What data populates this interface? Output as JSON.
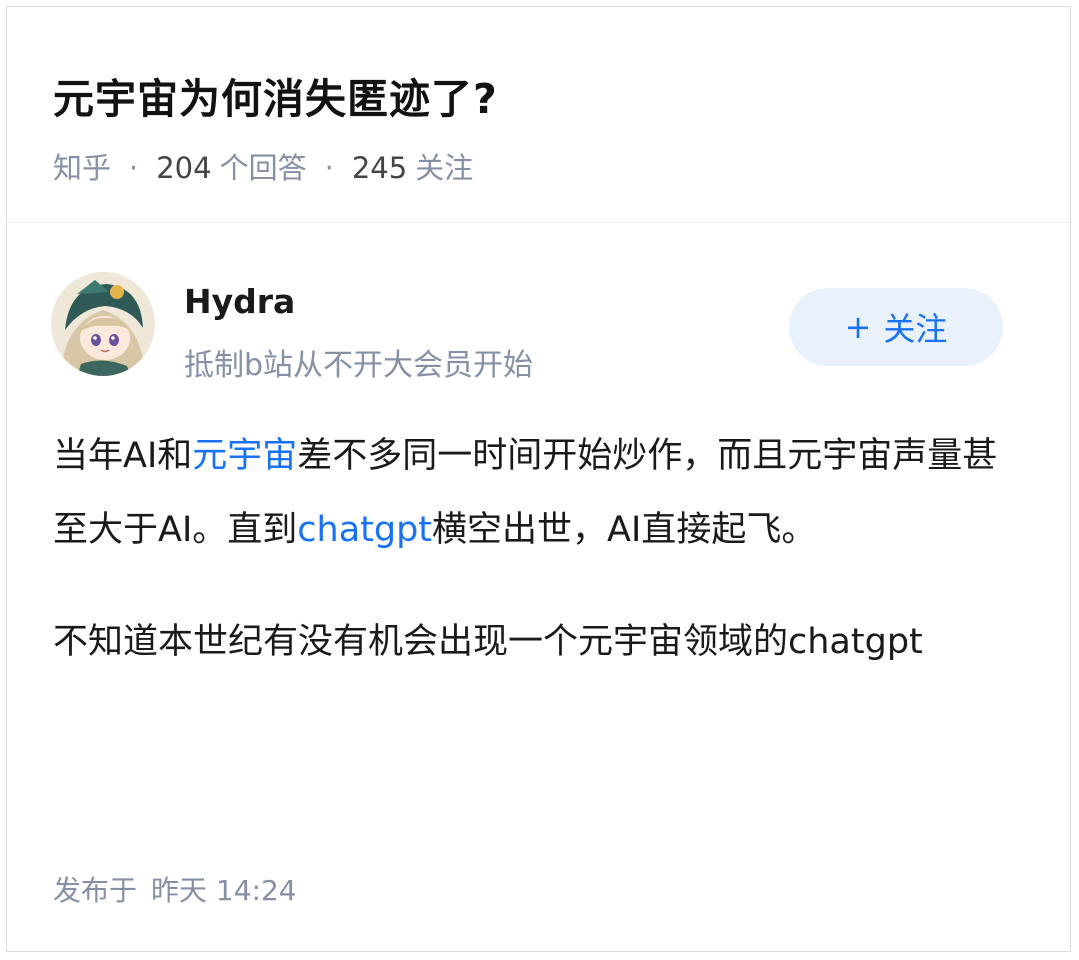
{
  "question": {
    "title": "元宇宙为何消失匿迹了?",
    "source": "知乎",
    "answer_count": "204",
    "answer_label": "个回答",
    "follower_count": "245",
    "follower_label": "关注"
  },
  "author": {
    "name": "Hydra",
    "bio": "抵制b站从不开大会员开始",
    "follow_label": "关注",
    "follow_plus": "+"
  },
  "answer": {
    "p1_a": "当年AI和",
    "p1_link1": "元宇宙",
    "p1_b": "差不多同一时间开始炒作，而且元宇宙声量甚至大于AI。直到",
    "p1_link2": "chatgpt",
    "p1_c": "横空出世，AI直接起飞。",
    "p2": "不知道本世纪有没有机会出现一个元宇宙领域的chatgpt"
  },
  "footer": {
    "publish_label": "发布于",
    "publish_time": "昨天 14:24"
  },
  "colors": {
    "link": "#1772f6",
    "meta": "#8590a6",
    "follow_bg": "#e9f1fc"
  }
}
